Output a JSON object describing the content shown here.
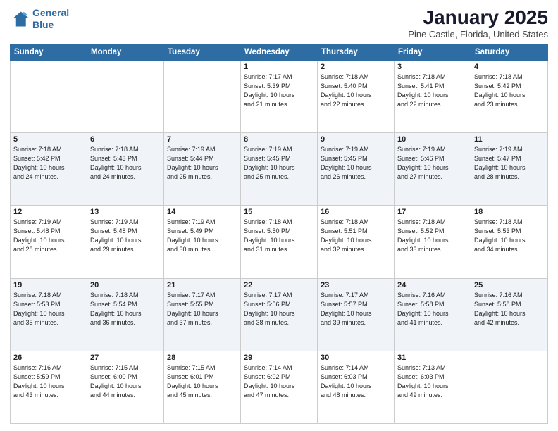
{
  "logo": {
    "line1": "General",
    "line2": "Blue"
  },
  "title": "January 2025",
  "subtitle": "Pine Castle, Florida, United States",
  "weekdays": [
    "Sunday",
    "Monday",
    "Tuesday",
    "Wednesday",
    "Thursday",
    "Friday",
    "Saturday"
  ],
  "weeks": [
    [
      {
        "day": "",
        "info": ""
      },
      {
        "day": "",
        "info": ""
      },
      {
        "day": "",
        "info": ""
      },
      {
        "day": "1",
        "info": "Sunrise: 7:17 AM\nSunset: 5:39 PM\nDaylight: 10 hours\nand 21 minutes."
      },
      {
        "day": "2",
        "info": "Sunrise: 7:18 AM\nSunset: 5:40 PM\nDaylight: 10 hours\nand 22 minutes."
      },
      {
        "day": "3",
        "info": "Sunrise: 7:18 AM\nSunset: 5:41 PM\nDaylight: 10 hours\nand 22 minutes."
      },
      {
        "day": "4",
        "info": "Sunrise: 7:18 AM\nSunset: 5:42 PM\nDaylight: 10 hours\nand 23 minutes."
      }
    ],
    [
      {
        "day": "5",
        "info": "Sunrise: 7:18 AM\nSunset: 5:42 PM\nDaylight: 10 hours\nand 24 minutes."
      },
      {
        "day": "6",
        "info": "Sunrise: 7:18 AM\nSunset: 5:43 PM\nDaylight: 10 hours\nand 24 minutes."
      },
      {
        "day": "7",
        "info": "Sunrise: 7:19 AM\nSunset: 5:44 PM\nDaylight: 10 hours\nand 25 minutes."
      },
      {
        "day": "8",
        "info": "Sunrise: 7:19 AM\nSunset: 5:45 PM\nDaylight: 10 hours\nand 25 minutes."
      },
      {
        "day": "9",
        "info": "Sunrise: 7:19 AM\nSunset: 5:45 PM\nDaylight: 10 hours\nand 26 minutes."
      },
      {
        "day": "10",
        "info": "Sunrise: 7:19 AM\nSunset: 5:46 PM\nDaylight: 10 hours\nand 27 minutes."
      },
      {
        "day": "11",
        "info": "Sunrise: 7:19 AM\nSunset: 5:47 PM\nDaylight: 10 hours\nand 28 minutes."
      }
    ],
    [
      {
        "day": "12",
        "info": "Sunrise: 7:19 AM\nSunset: 5:48 PM\nDaylight: 10 hours\nand 28 minutes."
      },
      {
        "day": "13",
        "info": "Sunrise: 7:19 AM\nSunset: 5:48 PM\nDaylight: 10 hours\nand 29 minutes."
      },
      {
        "day": "14",
        "info": "Sunrise: 7:19 AM\nSunset: 5:49 PM\nDaylight: 10 hours\nand 30 minutes."
      },
      {
        "day": "15",
        "info": "Sunrise: 7:18 AM\nSunset: 5:50 PM\nDaylight: 10 hours\nand 31 minutes."
      },
      {
        "day": "16",
        "info": "Sunrise: 7:18 AM\nSunset: 5:51 PM\nDaylight: 10 hours\nand 32 minutes."
      },
      {
        "day": "17",
        "info": "Sunrise: 7:18 AM\nSunset: 5:52 PM\nDaylight: 10 hours\nand 33 minutes."
      },
      {
        "day": "18",
        "info": "Sunrise: 7:18 AM\nSunset: 5:53 PM\nDaylight: 10 hours\nand 34 minutes."
      }
    ],
    [
      {
        "day": "19",
        "info": "Sunrise: 7:18 AM\nSunset: 5:53 PM\nDaylight: 10 hours\nand 35 minutes."
      },
      {
        "day": "20",
        "info": "Sunrise: 7:18 AM\nSunset: 5:54 PM\nDaylight: 10 hours\nand 36 minutes."
      },
      {
        "day": "21",
        "info": "Sunrise: 7:17 AM\nSunset: 5:55 PM\nDaylight: 10 hours\nand 37 minutes."
      },
      {
        "day": "22",
        "info": "Sunrise: 7:17 AM\nSunset: 5:56 PM\nDaylight: 10 hours\nand 38 minutes."
      },
      {
        "day": "23",
        "info": "Sunrise: 7:17 AM\nSunset: 5:57 PM\nDaylight: 10 hours\nand 39 minutes."
      },
      {
        "day": "24",
        "info": "Sunrise: 7:16 AM\nSunset: 5:58 PM\nDaylight: 10 hours\nand 41 minutes."
      },
      {
        "day": "25",
        "info": "Sunrise: 7:16 AM\nSunset: 5:58 PM\nDaylight: 10 hours\nand 42 minutes."
      }
    ],
    [
      {
        "day": "26",
        "info": "Sunrise: 7:16 AM\nSunset: 5:59 PM\nDaylight: 10 hours\nand 43 minutes."
      },
      {
        "day": "27",
        "info": "Sunrise: 7:15 AM\nSunset: 6:00 PM\nDaylight: 10 hours\nand 44 minutes."
      },
      {
        "day": "28",
        "info": "Sunrise: 7:15 AM\nSunset: 6:01 PM\nDaylight: 10 hours\nand 45 minutes."
      },
      {
        "day": "29",
        "info": "Sunrise: 7:14 AM\nSunset: 6:02 PM\nDaylight: 10 hours\nand 47 minutes."
      },
      {
        "day": "30",
        "info": "Sunrise: 7:14 AM\nSunset: 6:03 PM\nDaylight: 10 hours\nand 48 minutes."
      },
      {
        "day": "31",
        "info": "Sunrise: 7:13 AM\nSunset: 6:03 PM\nDaylight: 10 hours\nand 49 minutes."
      },
      {
        "day": "",
        "info": ""
      }
    ]
  ]
}
